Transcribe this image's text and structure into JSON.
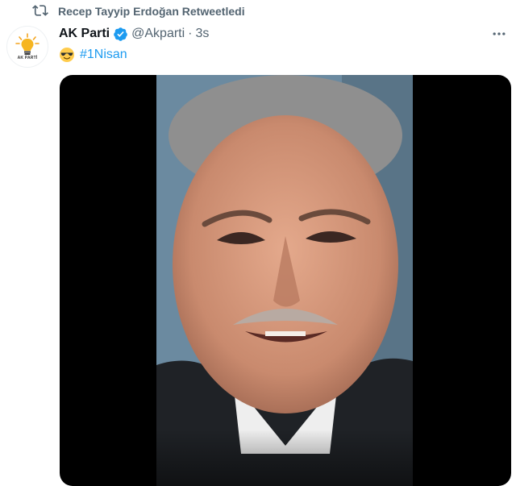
{
  "retweet": {
    "icon": "retweet-icon",
    "text": "Recep Tayyip Erdoğan Retweetledi"
  },
  "author": {
    "avatar_icon": "ak-parti-lightbulb-logo",
    "avatar_caption": "AK PARTİ",
    "name": "AK Parti",
    "verified_icon": "verified-badge-icon",
    "handle": "@Akparti",
    "separator": "·",
    "time": "3s"
  },
  "more_icon": "more-options-icon",
  "tweet": {
    "emoji": "smiling-face-with-sunglasses",
    "hashtag": "#1Nisan"
  },
  "media": {
    "type": "video",
    "description_icon": "video-frame"
  },
  "colors": {
    "accent": "#1d9bf0",
    "muted": "#536471",
    "text": "#0f1419",
    "media_bg": "#000000"
  }
}
